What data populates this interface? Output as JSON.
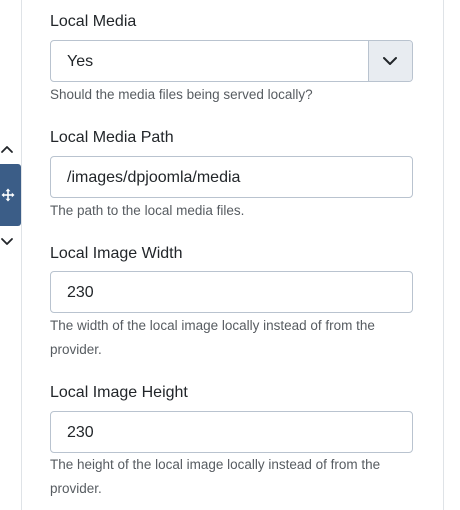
{
  "fields": [
    {
      "label": "Local Media",
      "value": "Yes",
      "type": "select",
      "help": "Should the media files being served locally?"
    },
    {
      "label": "Local Media Path",
      "value": "/images/dpjoomla/media",
      "type": "text",
      "help": "The path to the local media files."
    },
    {
      "label": "Local Image Width",
      "value": "230",
      "type": "text",
      "help": "The width of the local image locally instead of from the provider."
    },
    {
      "label": "Local Image Height",
      "value": "230",
      "type": "text",
      "help": "The height of the local image locally instead of from the provider."
    }
  ],
  "icons": {
    "select_arrow": "chevron-down-icon",
    "move_up": "chevron-up-icon",
    "move_down": "chevron-down-icon",
    "drag": "move-arrows-icon"
  },
  "colors": {
    "handle": "#3b5d87",
    "select_button_bg": "#e8ecf1",
    "input_border": "#b9c3cf",
    "label_text": "#22262a",
    "help_text": "#575c61"
  }
}
